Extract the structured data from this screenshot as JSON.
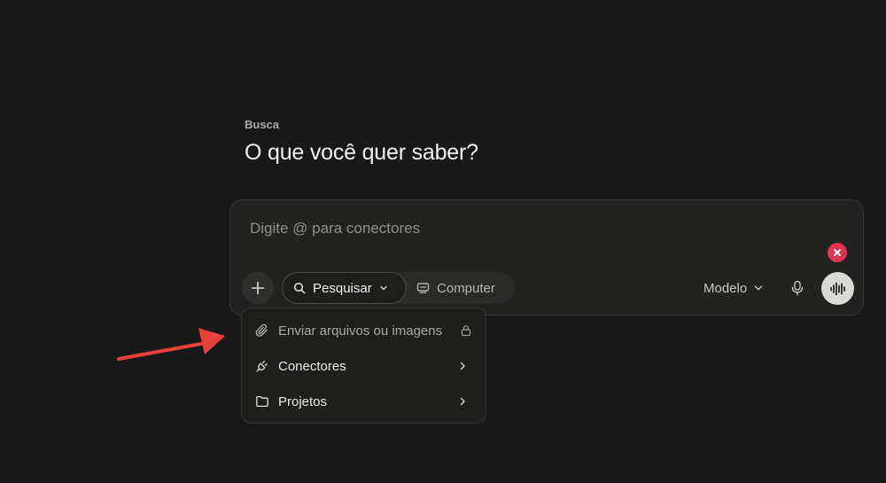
{
  "page": {
    "eyebrow": "Busca",
    "heading": "O que você quer saber?"
  },
  "composer": {
    "placeholder": "Digite @ para conectores",
    "value": "",
    "modes": {
      "search_label": "Pesquisar",
      "computer_label": "Computer",
      "active": "Pesquisar"
    },
    "model_label": "Modelo"
  },
  "attach_menu": {
    "items": [
      {
        "label": "Enviar arquivos ou imagens",
        "icon": "paperclip-icon",
        "trailing": "lock-icon",
        "disabled": true
      },
      {
        "label": "Conectores",
        "icon": "plug-icon",
        "trailing": "chevron-right-icon",
        "disabled": false
      },
      {
        "label": "Projetos",
        "icon": "folder-icon",
        "trailing": "chevron-right-icon",
        "disabled": false
      }
    ]
  },
  "colors": {
    "background": "#191919",
    "composer_bg": "#222221",
    "accent_red": "#e0344e",
    "annotation_arrow": "#e8413b",
    "voice_button": "#d9d9d6"
  },
  "icons": [
    "search-icon",
    "chevron-down-icon",
    "computer-icon",
    "plus-icon",
    "close-icon",
    "mic-icon",
    "waveform-icon",
    "paperclip-icon",
    "lock-icon",
    "plug-icon",
    "chevron-right-icon",
    "folder-icon",
    "arrow-annotation"
  ]
}
